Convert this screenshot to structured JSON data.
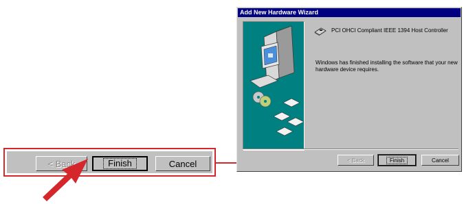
{
  "callout": {
    "back_label": "< Back",
    "finish_label": "Finish",
    "cancel_label": "Cancel"
  },
  "dialog": {
    "title": "Add New Hardware Wizard",
    "device_icon": "pci-card-icon",
    "device_name": "PCI OHCI Compliant IEEE 1394 Host Controller",
    "message": "Windows has finished installing the software that your new hardware device requires.",
    "buttons": {
      "back_label": "< Back",
      "finish_label": "Finish",
      "cancel_label": "Cancel"
    }
  },
  "colors": {
    "accent_red": "#d4262b",
    "titlebar": "#000080",
    "dialog_face": "#c0c0c0",
    "wizard_graphic": "#008080"
  }
}
